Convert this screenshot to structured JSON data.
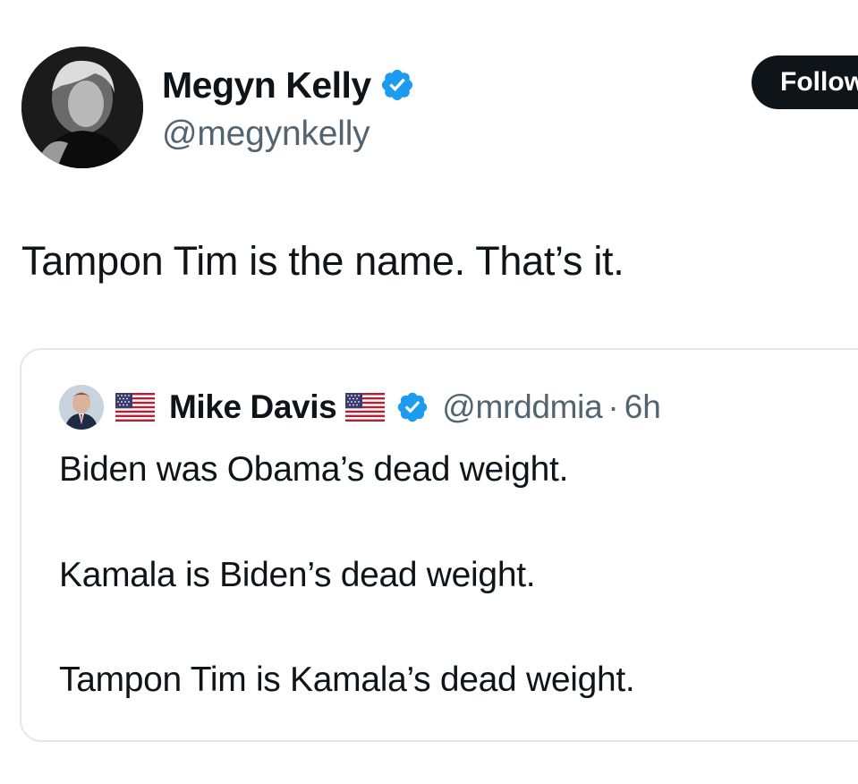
{
  "author": {
    "display_name": "Megyn Kelly",
    "handle": "@megynkelly",
    "avatar_icon": "profile-photo",
    "verified_icon": "verified-badge-icon",
    "verified_color": "#1d9bf0"
  },
  "follow_button": {
    "label": "Follow"
  },
  "tweet": {
    "text": "Tampon Tim is the name. That’s it."
  },
  "quoted_tweet": {
    "display_name": "Mike Davis",
    "flag_icon": "us-flag-icon",
    "verified_icon": "verified-badge-icon",
    "handle": "@mrddmia",
    "separator": "·",
    "time": "6h",
    "lines": [
      "Biden was Obama’s dead weight.",
      "Kamala is Biden’s dead weight.",
      "Tampon Tim is Kamala’s dead weight."
    ]
  },
  "colors": {
    "text_primary": "#0f1419",
    "text_secondary": "#536471",
    "border": "#e4e8eb",
    "button_bg": "#0f1419"
  }
}
